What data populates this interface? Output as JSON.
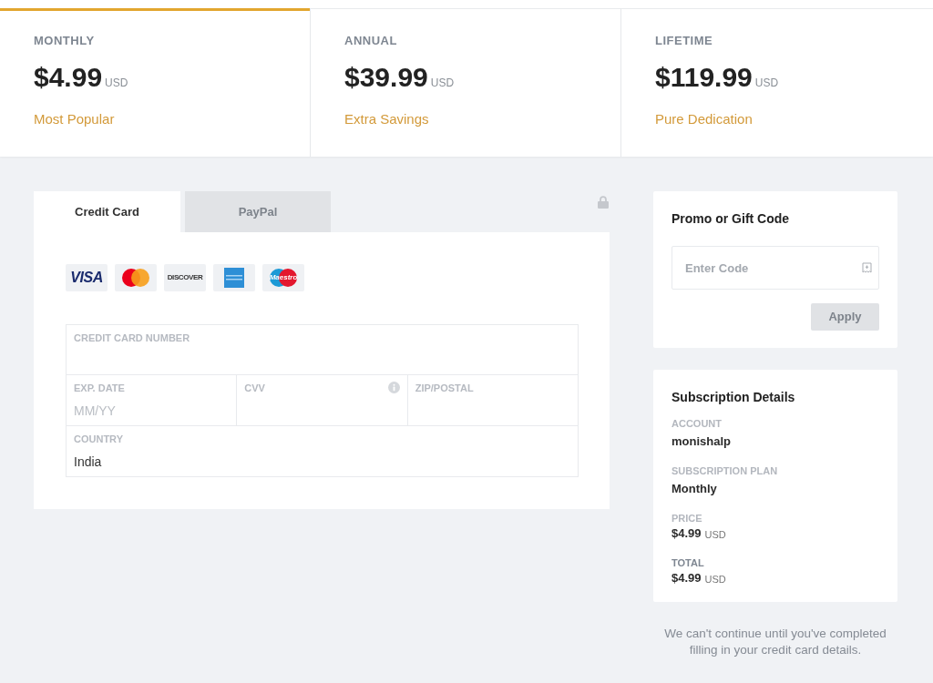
{
  "plans": [
    {
      "name": "MONTHLY",
      "price": "$4.99",
      "currency": "USD",
      "tagline": "Most Popular",
      "selected": true
    },
    {
      "name": "ANNUAL",
      "price": "$39.99",
      "currency": "USD",
      "tagline": "Extra Savings",
      "selected": false
    },
    {
      "name": "LIFETIME",
      "price": "$119.99",
      "currency": "USD",
      "tagline": "Pure Dedication",
      "selected": false
    }
  ],
  "payment": {
    "tabs": [
      {
        "label": "Credit Card",
        "selected": true
      },
      {
        "label": "PayPal",
        "selected": false
      }
    ],
    "card_logos": [
      {
        "kind": "visa",
        "text": "VISA"
      },
      {
        "kind": "mastercard"
      },
      {
        "kind": "discover",
        "text": "DISCOVER"
      },
      {
        "kind": "amex"
      },
      {
        "kind": "maestro",
        "text": "Maestro"
      }
    ],
    "form_rows": [
      {
        "fields": [
          {
            "label": "CREDIT CARD NUMBER",
            "kind": "plain"
          }
        ]
      },
      {
        "fields": [
          {
            "label": "EXP. DATE",
            "kind": "plain",
            "placeholder": "MM/YY"
          },
          {
            "label": "CVV",
            "kind": "info"
          },
          {
            "label": "ZIP/POSTAL",
            "kind": "plain"
          }
        ]
      },
      {
        "fields": [
          {
            "label": "COUNTRY",
            "kind": "plain",
            "value": "India"
          }
        ]
      }
    ]
  },
  "promo": {
    "title": "Promo or Gift Code",
    "placeholder": "Enter Code",
    "button": {
      "label": "Apply",
      "disabled": true
    }
  },
  "subscription": {
    "title": "Subscription Details",
    "items": [
      {
        "label": "ACCOUNT",
        "value": "monishalp",
        "emphasized": false
      },
      {
        "label": "SUBSCRIPTION PLAN",
        "value": "Monthly",
        "emphasized": false
      },
      {
        "label": "PRICE",
        "value": "$4.99",
        "currency": "USD",
        "emphasized": false
      },
      {
        "label": "TOTAL",
        "value": "$4.99",
        "currency": "USD",
        "emphasized": true
      }
    ]
  },
  "notice": "We can't continue until you've completed filling in your credit card details."
}
